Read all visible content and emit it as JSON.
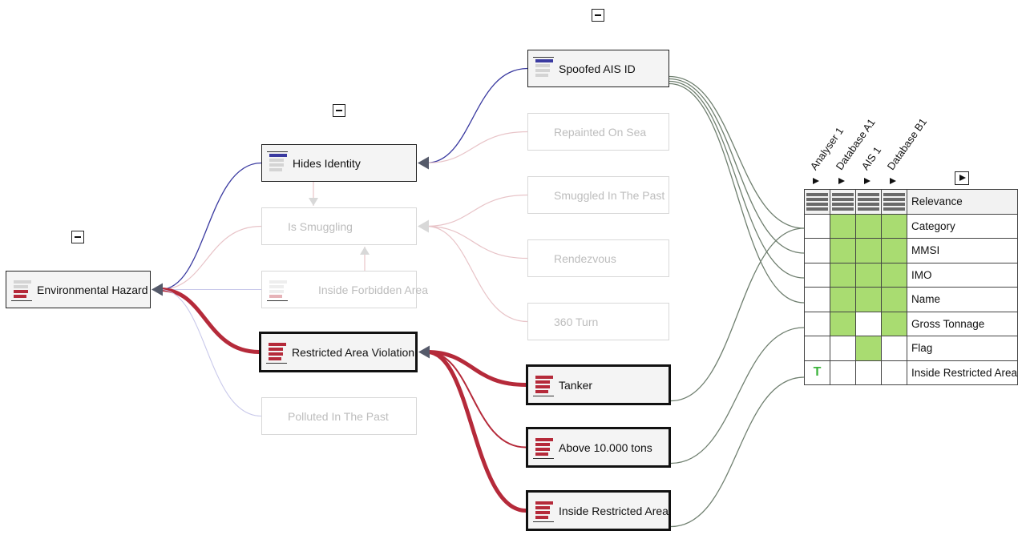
{
  "colors": {
    "evidence_red": "#b52a3a",
    "identity_blue": "#3a3aa0",
    "faded_pink": "#e8c4c8",
    "faded_blue": "#c8c8ea",
    "link_gray": "#6f7f6f",
    "match_green": "#a9dc71",
    "true_green": "#3cb43c"
  },
  "graph": {
    "nodes": {
      "environmental_hazard": {
        "label": "Environmental Hazard",
        "state": "active",
        "icon": "stacked-bars-icon",
        "bars": [
          "gray",
          "gray",
          "red",
          "red"
        ]
      },
      "hides_identity": {
        "label": "Hides Identity",
        "state": "active",
        "icon": "stacked-bars-icon",
        "bars": [
          "blue",
          "gray",
          "gray",
          "gray"
        ]
      },
      "is_smuggling": {
        "label": "Is Smuggling",
        "state": "faded"
      },
      "inside_forbidden_area": {
        "label": "Inside Forbidden Area",
        "state": "faded",
        "icon": "stacked-bars-icon",
        "bars": [
          "faint",
          "faint",
          "faint",
          "pink"
        ]
      },
      "restricted_area_violation": {
        "label": "Restricted Area Violation",
        "state": "strong",
        "icon": "stacked-bars-icon",
        "bars": [
          "red",
          "red",
          "red",
          "red"
        ]
      },
      "polluted_in_the_past": {
        "label": "Polluted In The Past",
        "state": "faded"
      },
      "spoofed_ais_id": {
        "label": "Spoofed AIS ID",
        "state": "active",
        "icon": "stacked-bars-icon",
        "bars": [
          "blue",
          "gray",
          "gray",
          "gray"
        ]
      },
      "repainted_on_sea": {
        "label": "Repainted On Sea",
        "state": "faded"
      },
      "smuggled_in_the_past": {
        "label": "Smuggled In The Past",
        "state": "faded"
      },
      "rendezvous": {
        "label": "Rendezvous",
        "state": "faded"
      },
      "turn_360": {
        "label": "360 Turn",
        "state": "faded"
      },
      "tanker": {
        "label": "Tanker",
        "state": "strong",
        "icon": "stacked-bars-icon",
        "bars": [
          "red",
          "red",
          "red",
          "red"
        ]
      },
      "above_10000_tons": {
        "label": "Above 10.000 tons",
        "state": "strong",
        "icon": "stacked-bars-icon",
        "bars": [
          "red",
          "red",
          "red",
          "red"
        ]
      },
      "inside_restricted_area": {
        "label": "Inside Restricted Area",
        "state": "strong",
        "icon": "stacked-bars-icon",
        "bars": [
          "red",
          "red",
          "red",
          "red"
        ]
      }
    },
    "edges": [
      {
        "from": "hides_identity",
        "to": "environmental_hazard",
        "style": "blue"
      },
      {
        "from": "is_smuggling",
        "to": "environmental_hazard",
        "style": "faded-pink"
      },
      {
        "from": "inside_forbidden_area",
        "to": "environmental_hazard",
        "style": "faded-blue"
      },
      {
        "from": "restricted_area_violation",
        "to": "environmental_hazard",
        "style": "red-thick"
      },
      {
        "from": "polluted_in_the_past",
        "to": "environmental_hazard",
        "style": "faded-blue"
      },
      {
        "from": "spoofed_ais_id",
        "to": "hides_identity",
        "style": "blue"
      },
      {
        "from": "repainted_on_sea",
        "to": "hides_identity",
        "style": "faded-pink"
      },
      {
        "from": "hides_identity",
        "to": "is_smuggling",
        "style": "faded-vertical"
      },
      {
        "from": "inside_forbidden_area",
        "to": "is_smuggling",
        "style": "faded-vertical"
      },
      {
        "from": "smuggled_in_the_past",
        "to": "is_smuggling",
        "style": "faded-pink"
      },
      {
        "from": "rendezvous",
        "to": "is_smuggling",
        "style": "faded-pink"
      },
      {
        "from": "turn_360",
        "to": "is_smuggling",
        "style": "faded-pink"
      },
      {
        "from": "tanker",
        "to": "restricted_area_violation",
        "style": "red-thick"
      },
      {
        "from": "above_10000_tons",
        "to": "restricted_area_violation",
        "style": "red-thin"
      },
      {
        "from": "inside_restricted_area",
        "to": "restricted_area_violation",
        "style": "red-thick"
      }
    ],
    "attribute_links": [
      {
        "from": "spoofed_ais_id",
        "to": "Category"
      },
      {
        "from": "spoofed_ais_id",
        "to": "MMSI"
      },
      {
        "from": "spoofed_ais_id",
        "to": "IMO"
      },
      {
        "from": "spoofed_ais_id",
        "to": "Name"
      },
      {
        "from": "tanker",
        "to": "Category"
      },
      {
        "from": "above_10000_tons",
        "to": "Gross Tonnage"
      },
      {
        "from": "inside_restricted_area",
        "to": "Inside Restricted Area"
      }
    ]
  },
  "matrix": {
    "sources": [
      "Analyser 1",
      "Database A1",
      "AIS 1",
      "Database B1"
    ],
    "header_label": "Relevance",
    "rows": [
      {
        "label": "Category",
        "cells": [
          false,
          true,
          true,
          true
        ],
        "mark": ""
      },
      {
        "label": "MMSI",
        "cells": [
          false,
          true,
          true,
          true
        ],
        "mark": ""
      },
      {
        "label": "IMO",
        "cells": [
          false,
          true,
          true,
          true
        ],
        "mark": ""
      },
      {
        "label": "Name",
        "cells": [
          false,
          true,
          true,
          true
        ],
        "mark": ""
      },
      {
        "label": "Gross Tonnage",
        "cells": [
          false,
          true,
          false,
          true
        ],
        "mark": ""
      },
      {
        "label": "Flag",
        "cells": [
          false,
          false,
          true,
          false
        ],
        "mark": ""
      },
      {
        "label": "Inside Restricted Area",
        "cells": [
          false,
          false,
          false,
          false
        ],
        "mark": "T"
      }
    ]
  }
}
